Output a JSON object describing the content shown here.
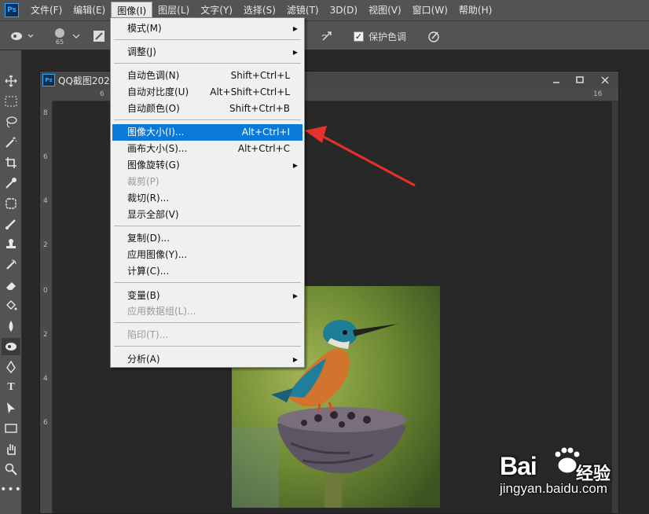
{
  "app": {
    "logo_text": "Ps"
  },
  "menubar": {
    "items": [
      "文件(F)",
      "编辑(E)",
      "图像(I)",
      "图层(L)",
      "文字(Y)",
      "选择(S)",
      "滤镜(T)",
      "3D(D)",
      "视图(V)",
      "窗口(W)",
      "帮助(H)"
    ]
  },
  "options": {
    "brush_size": "65",
    "protect_tones_label": "保护色调"
  },
  "document": {
    "title": "QQ截图202",
    "ruler_top": [
      "6",
      "16"
    ],
    "ruler_left": [
      "8",
      "6",
      "4",
      "2",
      "0",
      "2",
      "4",
      "6"
    ]
  },
  "dropdown": {
    "items": [
      {
        "label": "模式(M)",
        "shortcut": "",
        "submenu": true,
        "disabled": false
      },
      {
        "label": "调整(J)",
        "shortcut": "",
        "submenu": true,
        "disabled": false
      },
      {
        "label": "自动色调(N)",
        "shortcut": "Shift+Ctrl+L",
        "submenu": false,
        "disabled": false
      },
      {
        "label": "自动对比度(U)",
        "shortcut": "Alt+Shift+Ctrl+L",
        "submenu": false,
        "disabled": false
      },
      {
        "label": "自动颜色(O)",
        "shortcut": "Shift+Ctrl+B",
        "submenu": false,
        "disabled": false
      },
      {
        "label": "图像大小(I)...",
        "shortcut": "Alt+Ctrl+I",
        "submenu": false,
        "disabled": false,
        "highlighted": true
      },
      {
        "label": "画布大小(S)...",
        "shortcut": "Alt+Ctrl+C",
        "submenu": false,
        "disabled": false
      },
      {
        "label": "图像旋转(G)",
        "shortcut": "",
        "submenu": true,
        "disabled": false
      },
      {
        "label": "裁剪(P)",
        "shortcut": "",
        "submenu": false,
        "disabled": true
      },
      {
        "label": "裁切(R)...",
        "shortcut": "",
        "submenu": false,
        "disabled": false
      },
      {
        "label": "显示全部(V)",
        "shortcut": "",
        "submenu": false,
        "disabled": false
      },
      {
        "label": "复制(D)...",
        "shortcut": "",
        "submenu": false,
        "disabled": false
      },
      {
        "label": "应用图像(Y)...",
        "shortcut": "",
        "submenu": false,
        "disabled": false
      },
      {
        "label": "计算(C)...",
        "shortcut": "",
        "submenu": false,
        "disabled": false
      },
      {
        "label": "变量(B)",
        "shortcut": "",
        "submenu": true,
        "disabled": false
      },
      {
        "label": "应用数据组(L)...",
        "shortcut": "",
        "submenu": false,
        "disabled": true
      },
      {
        "label": "陷印(T)...",
        "shortcut": "",
        "submenu": false,
        "disabled": true
      },
      {
        "label": "分析(A)",
        "shortcut": "",
        "submenu": true,
        "disabled": false
      }
    ]
  },
  "watermark": {
    "logo": "Bai",
    "logo_suffix": "经验",
    "url": "jingyan.baidu.com"
  },
  "colors": {
    "highlight": "#0a7ad8",
    "arrow": "#e8302a"
  }
}
